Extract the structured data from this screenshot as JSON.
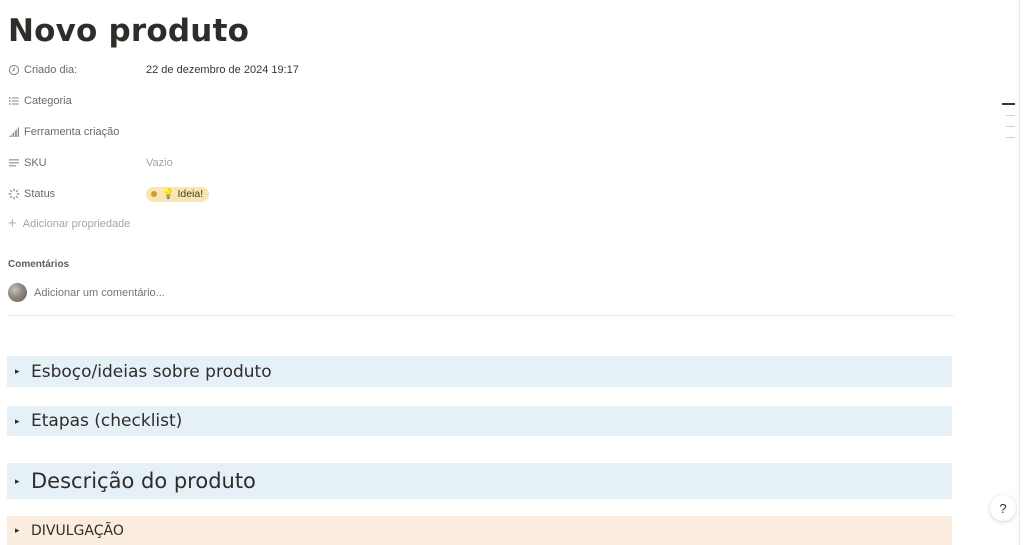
{
  "page": {
    "title": "Novo produto"
  },
  "properties": [
    {
      "name": "Criado dia:",
      "value": "22 de dezembro de 2024 19:17",
      "icon": "clock-icon"
    },
    {
      "name": "Categoria",
      "value": "",
      "icon": "list-icon"
    },
    {
      "name": "Ferramenta criação",
      "value": "",
      "icon": "signal-bars-icon"
    },
    {
      "name": "SKU",
      "value": "Vazio",
      "icon": "text-lines-icon"
    },
    {
      "name": "Status",
      "value": "Ideia!",
      "icon": "status-spinner-icon"
    }
  ],
  "status": {
    "bulb_glyph": "💡",
    "color": "#f7e6b4"
  },
  "add_property_label": "Adicionar propriedade",
  "comments": {
    "label": "Comentários",
    "placeholder": "Adicionar um comentário..."
  },
  "toggles": [
    {
      "label": "Esboço/ideias sobre produto",
      "color": "#e6f1f7"
    },
    {
      "label": "Etapas (checklist)",
      "color": "#e6f1f7"
    },
    {
      "label": "Descrição do produto",
      "color": "#e6f1f7"
    },
    {
      "label": "DIVULGAÇÃO",
      "color": "#fbece0"
    }
  ],
  "toggle_glyph": "▸",
  "help_glyph": "?"
}
